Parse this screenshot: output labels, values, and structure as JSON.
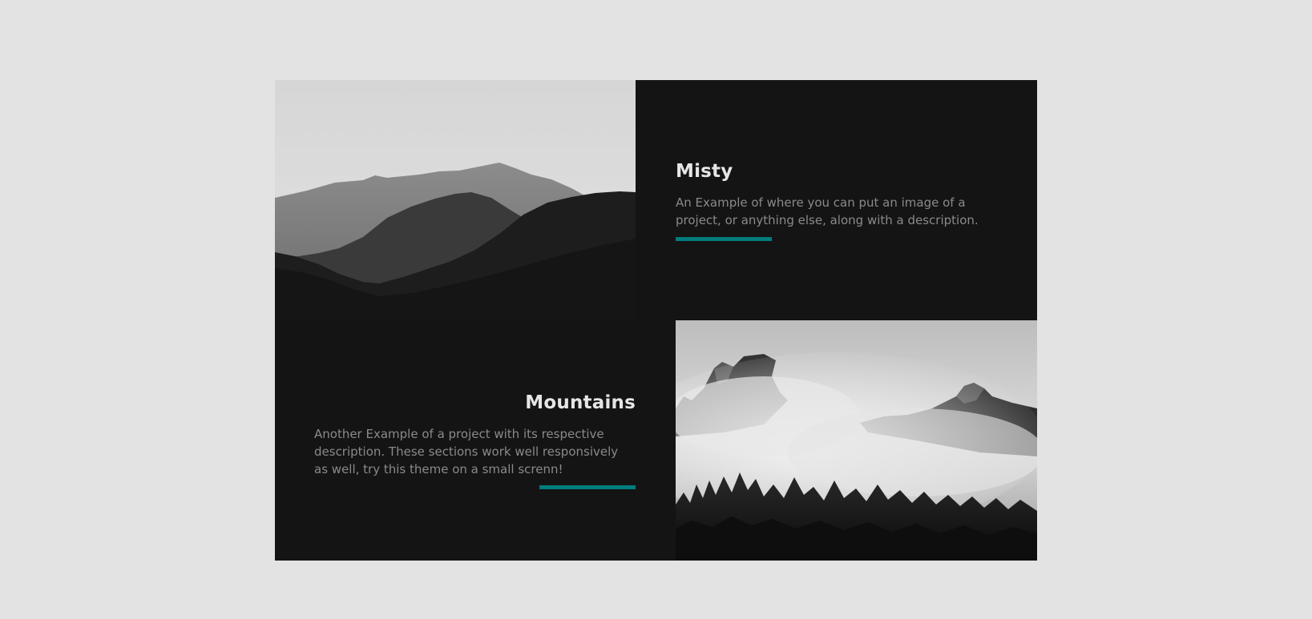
{
  "projects": [
    {
      "title": "Misty",
      "description": "An Example of where you can put an image of a project, or anything else, along with a description.",
      "image_icon": "mountain-silhouette-image"
    },
    {
      "title": "Mountains",
      "description": "Another Example of a project with its respective description. These sections work well responsively as well, try this theme on a small screnn!",
      "image_icon": "foggy-peaks-image"
    }
  ],
  "colors": {
    "page_background": "#e3e3e3",
    "section_background": "#141414",
    "accent": "#007c7c",
    "title_text": "#e6e6e6",
    "description_text": "#8a8a8a"
  }
}
